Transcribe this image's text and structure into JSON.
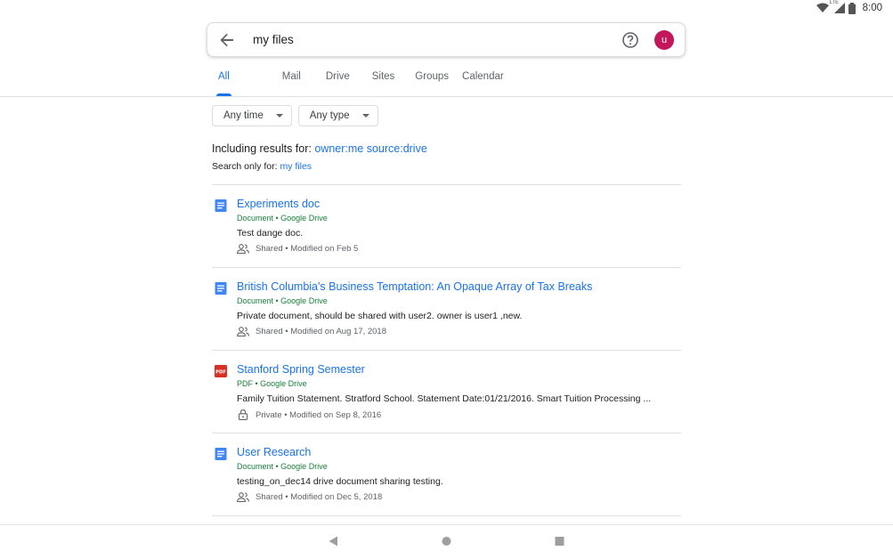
{
  "status_bar": {
    "time": "8:00",
    "network_label": "LTE"
  },
  "search": {
    "query": "my files",
    "avatar_letter": "u"
  },
  "tabs": [
    {
      "label": "All",
      "active": true
    },
    {
      "label": "Mail"
    },
    {
      "label": "Drive"
    },
    {
      "label": "Sites"
    },
    {
      "label": "Groups"
    },
    {
      "label": "Calendar"
    }
  ],
  "filters": {
    "time": "Any time",
    "type": "Any type"
  },
  "including": {
    "prefix": "Including results for:",
    "query": "owner:me source:drive",
    "search_only_prefix": "Search only for:",
    "search_only_query": "my files"
  },
  "results": [
    {
      "icon": "doc-icon",
      "title": "Experiments doc",
      "source": "Document • Google Drive",
      "snippet": "Test dange doc.",
      "meta_icon": "shared-icon",
      "meta": "Shared • Modified on Feb 5"
    },
    {
      "icon": "doc-icon",
      "title": "British Columbia's Business Temptation: An Opaque Array of Tax Breaks",
      "source": "Document • Google Drive",
      "snippet": "Private document, should be shared with user2. owner is user1 ,new.",
      "meta_icon": "shared-icon",
      "meta": "Shared • Modified on Aug 17, 2018"
    },
    {
      "icon": "pdf-icon",
      "title": "Stanford Spring Semester",
      "source": "PDF • Google Drive",
      "snippet": "Family Tuition Statement. Stratford School. Statement Date:01/21/2016. Smart Tuition Processing ...",
      "meta_icon": "lock-icon",
      "meta": "Private • Modified on Sep 8, 2016"
    },
    {
      "icon": "doc-icon",
      "title": "User Research",
      "source": "Document • Google Drive",
      "snippet": "testing_on_dec14 drive document sharing testing.",
      "meta_icon": "shared-icon",
      "meta": "Shared • Modified on Dec 5, 2018"
    }
  ],
  "colors": {
    "accent": "#1a73e8",
    "source_green": "#188038",
    "avatar": "#c2185b",
    "pdf_red": "#d93025"
  }
}
